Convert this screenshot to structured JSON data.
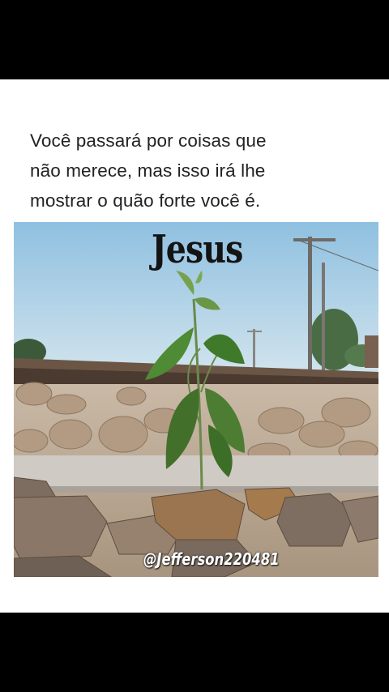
{
  "post": {
    "caption_lines": [
      "Você passará por coisas que",
      "não merece, mas isso irá lhe",
      "mostrar o quão forte você é."
    ]
  },
  "image": {
    "overlay_title": "Jesus",
    "watermark": "@Jefferson220481"
  },
  "colors": {
    "background": "#000000",
    "card": "#ffffff",
    "text": "#222222",
    "sky": "#a9cfe6",
    "leaf": "#3f7a2a"
  }
}
